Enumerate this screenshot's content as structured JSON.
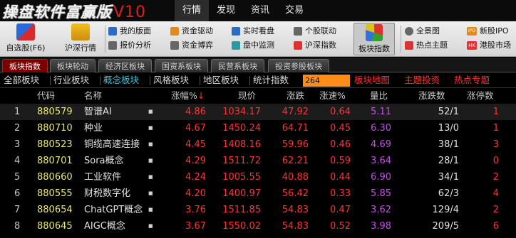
{
  "app": {
    "logo": "操盘软件富赢版",
    "version": "V10",
    "menu": [
      "行情",
      "发现",
      "资讯",
      "交易"
    ],
    "active_menu": "行情"
  },
  "toolbar": {
    "zixuan": "自选股(F6)",
    "hushen": "沪深行情",
    "wode": "我的版面",
    "baojia": "报价分析",
    "zijin_qudong": "资金驱动",
    "zijin_boyi": "资金博弈",
    "shishi": "实时看盘",
    "panzhong": "盘中监测",
    "gegu": "个股联动",
    "hushen_zhishu": "沪深指数",
    "bankuai": "板块指数",
    "quanjing": "全景图",
    "redian": "热点主题",
    "ipo_badge": "IPO",
    "xingu": "新股IPO",
    "hk_badge": "HK",
    "ganggu": "港股市场"
  },
  "category_tabs": [
    "板块指数",
    "板块轮动",
    "经济区板块",
    "国资系板块",
    "民营系板块",
    "投资参股板块"
  ],
  "filter": {
    "items": [
      "全部板块",
      "行业板块",
      "概念板块",
      "风格板块",
      "地区板块",
      "统计指数"
    ],
    "active": "概念板块",
    "count": "264",
    "links": [
      "板块地图",
      "主题投资",
      "热点专题"
    ]
  },
  "table": {
    "headers": {
      "code": "代码",
      "name": "名称",
      "chg_pct": "涨幅%",
      "sort_arrow": "↓",
      "price": "现价",
      "chg": "涨跌",
      "speed": "涨速%",
      "ratio": "量比",
      "updown": "涨跌数",
      "limit": "涨停数"
    },
    "rows": [
      {
        "n": "1",
        "code": "880579",
        "name": "智谱AI",
        "chg_pct": "4.86",
        "price": "1034.17",
        "chg": "47.92",
        "speed": "0.64",
        "ratio": "5.11",
        "updown": "52/1",
        "limit": "1"
      },
      {
        "n": "2",
        "code": "880710",
        "name": "种业",
        "chg_pct": "4.67",
        "price": "1450.24",
        "chg": "64.71",
        "speed": "0.45",
        "ratio": "6.30",
        "updown": "13/0",
        "limit": "1"
      },
      {
        "n": "3",
        "code": "880523",
        "name": "铜缆高速连接",
        "chg_pct": "4.45",
        "price": "1408.16",
        "chg": "59.96",
        "speed": "0.46",
        "ratio": "4.69",
        "updown": "38/1",
        "limit": "3"
      },
      {
        "n": "4",
        "code": "880701",
        "name": "Sora概念",
        "chg_pct": "4.29",
        "price": "1511.72",
        "chg": "62.21",
        "speed": "0.59",
        "ratio": "3.64",
        "updown": "28/1",
        "limit": "0"
      },
      {
        "n": "5",
        "code": "880660",
        "name": "工业软件",
        "chg_pct": "4.24",
        "price": "1005.55",
        "chg": "40.88",
        "speed": "0.44",
        "ratio": "6.90",
        "updown": "34/1",
        "limit": "2"
      },
      {
        "n": "6",
        "code": "880555",
        "name": "财税数字化",
        "chg_pct": "4.20",
        "price": "1400.97",
        "chg": "56.42",
        "speed": "0.33",
        "ratio": "5.85",
        "updown": "62/3",
        "limit": "4"
      },
      {
        "n": "7",
        "code": "880654",
        "name": "ChatGPT概念",
        "chg_pct": "3.76",
        "price": "1511.85",
        "chg": "54.83",
        "speed": "0.47",
        "ratio": "3.62",
        "updown": "129/4",
        "limit": "2"
      },
      {
        "n": "8",
        "code": "880645",
        "name": "AIGC概念",
        "chg_pct": "3.67",
        "price": "1550.02",
        "chg": "54.83",
        "speed": "0.52",
        "ratio": "3.98",
        "updown": "209/5",
        "limit": "6"
      }
    ]
  },
  "colors": {
    "up": "#ff3333",
    "code": "#e8e870",
    "ratio": "#c050e0",
    "active_filter": "#38c8e0",
    "count_box": "#ff8c1a"
  }
}
